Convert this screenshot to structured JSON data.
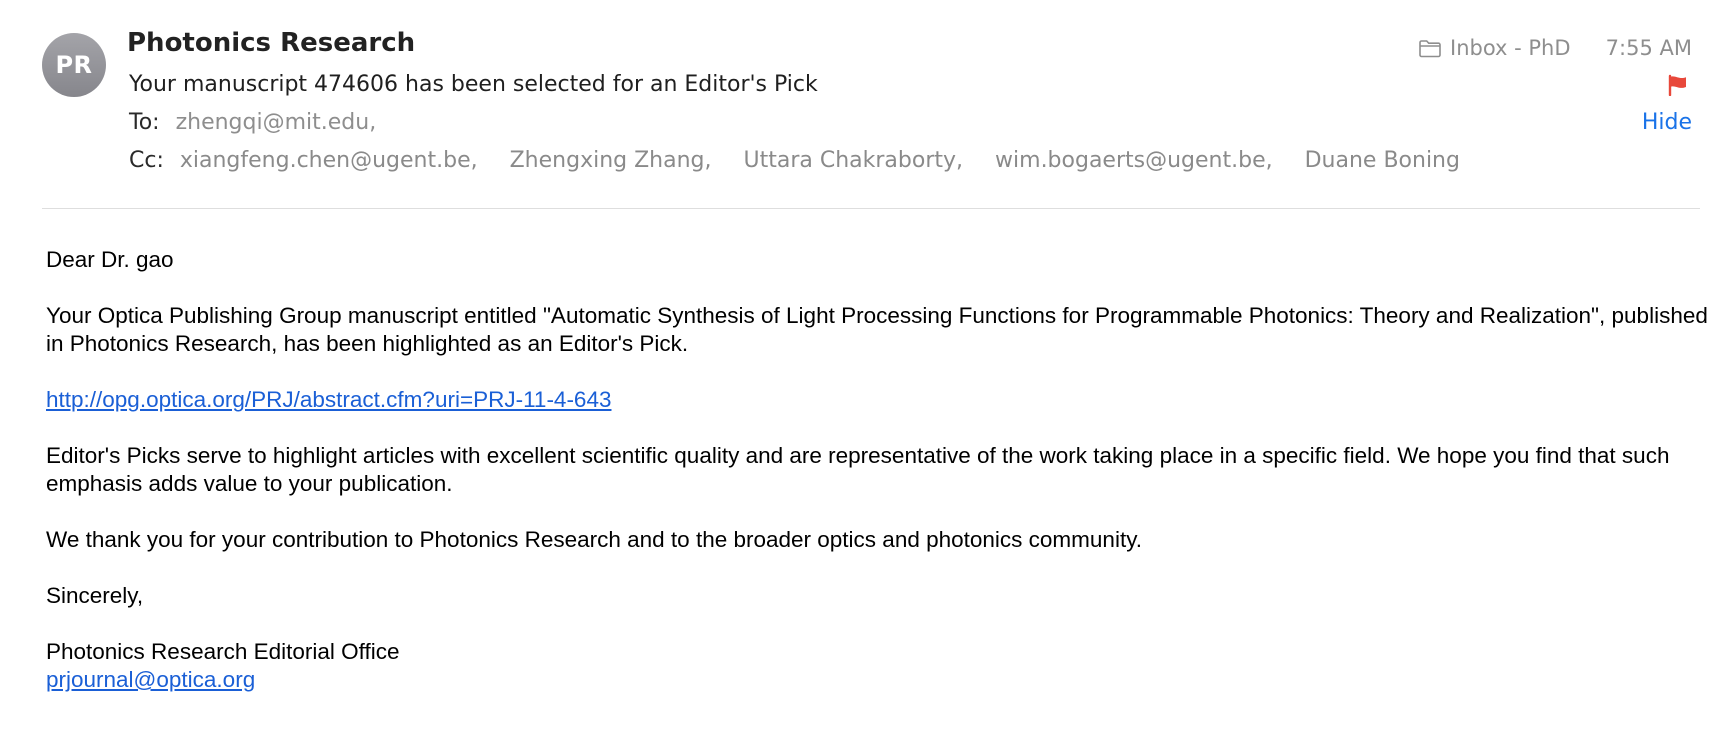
{
  "header": {
    "avatar_initials": "PR",
    "sender": "Photonics Research",
    "subject": "Your manuscript 474606 has been selected for an Editor's Pick",
    "mailbox": "Inbox - PhD",
    "time": "7:55 AM",
    "hide_label": "Hide",
    "to_label": "To:",
    "to": [
      "zhengqi@mit.edu,"
    ],
    "cc_label": "Cc:",
    "cc": [
      "xiangfeng.chen@ugent.be,",
      "Zhengxing Zhang,",
      "Uttara Chakraborty,",
      "wim.bogaerts@ugent.be,",
      "Duane Boning"
    ],
    "icons": {
      "mailbox": "folder-icon",
      "flag": "flag-icon"
    },
    "colors": {
      "flag": "#e8483b",
      "link": "#1a5fd6",
      "hide": "#1a73e8",
      "avatar": "#96969b"
    }
  },
  "body": {
    "greeting": "Dear Dr. gao",
    "paragraph1": "Your Optica Publishing Group manuscript entitled \"Automatic Synthesis of Light Processing Functions for Programmable Photonics: Theory and Realization\", published in Photonics Research, has been highlighted as an Editor's Pick.",
    "link": "http://opg.optica.org/PRJ/abstract.cfm?uri=PRJ-11-4-643",
    "paragraph2": "Editor's Picks serve to highlight articles with excellent scientific quality and are representative of the work taking place in a specific field. We hope you find that such emphasis adds value to your publication.",
    "paragraph3": "We thank you for your contribution to Photonics Research and to the broader optics and photonics community.",
    "closing": "Sincerely,",
    "signature_name": "Photonics Research Editorial Office",
    "signature_email": "prjournal@optica.org"
  }
}
